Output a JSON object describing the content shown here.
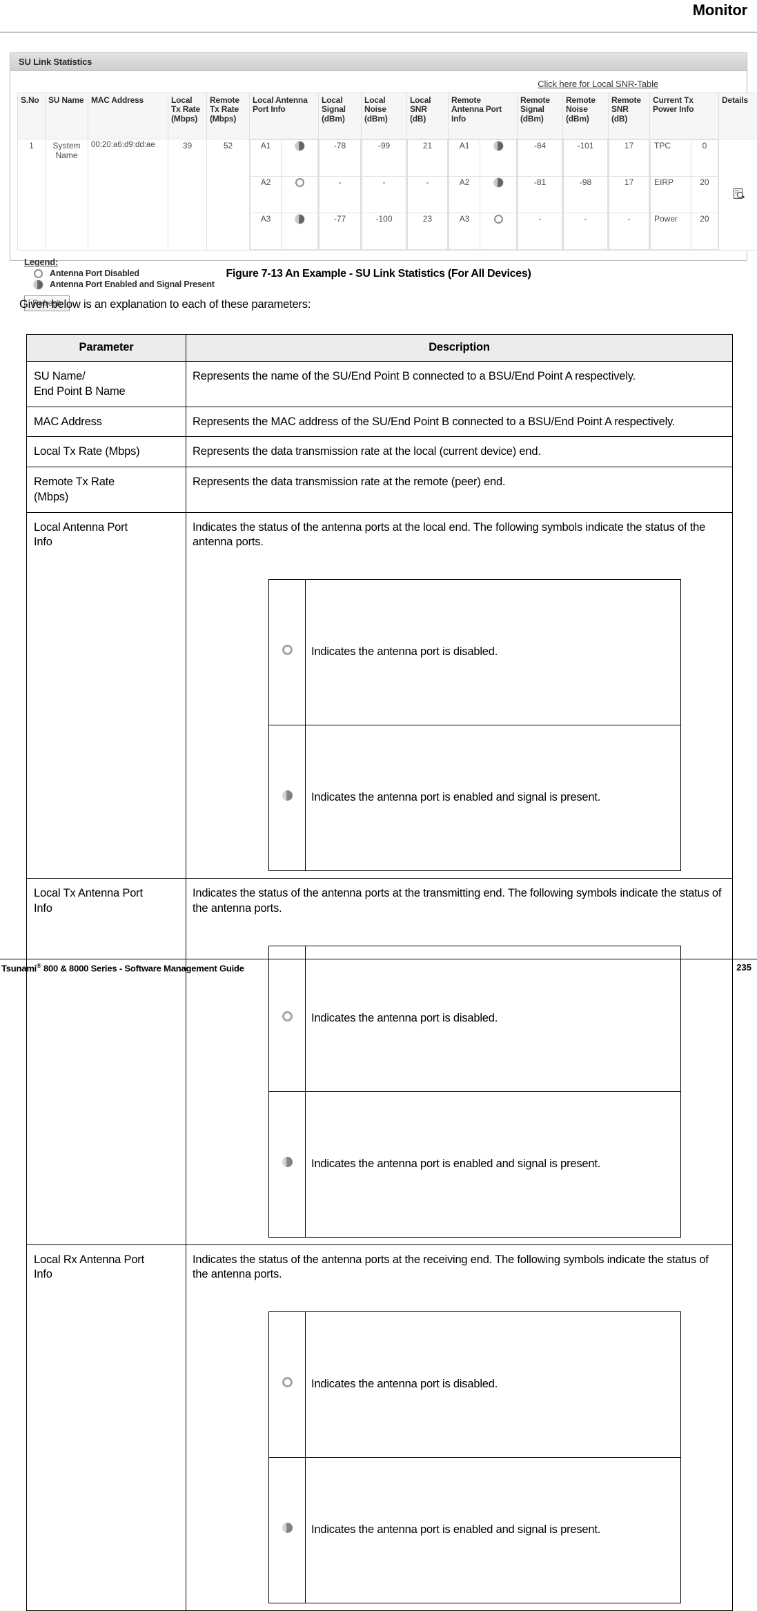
{
  "page": {
    "running_head": "Monitor",
    "footer_left_main": "Tsunami",
    "footer_left_sup": "®",
    "footer_left_rest": " 800 & 8000 Series - Software Management Guide",
    "footer_page_number": "235"
  },
  "screenshot": {
    "panel_title": "SU Link Statistics",
    "snr_link": "Click here for Local SNR-Table",
    "columns": [
      "S.No",
      "SU Name",
      "MAC Address",
      "Local Tx Rate (Mbps)",
      "Remote Tx Rate (Mbps)",
      "Local Antenna Port Info",
      "Local Signal (dBm)",
      "Local Noise (dBm)",
      "Local SNR (dB)",
      "Remote Antenna Port Info",
      "Remote Signal (dBm)",
      "Remote Noise (dBm)",
      "Remote SNR (dB)",
      "Current Tx Power Info",
      "Details"
    ],
    "row": {
      "sno": "1",
      "su_name": "System Name",
      "mac_address": "00:20:a6:d9:dd:ae",
      "local_tx_rate": "39",
      "remote_tx_rate": "52",
      "local_antenna_ports": [
        {
          "label": "A1",
          "state": "enabled"
        },
        {
          "label": "A2",
          "state": "disabled"
        },
        {
          "label": "A3",
          "state": "enabled"
        }
      ],
      "local_signal": [
        "-78",
        "-",
        "-77"
      ],
      "local_noise": [
        "-99",
        "-",
        "-100"
      ],
      "local_snr": [
        "21",
        "-",
        "23"
      ],
      "remote_antenna_ports": [
        {
          "label": "A1",
          "state": "enabled"
        },
        {
          "label": "A2",
          "state": "enabled"
        },
        {
          "label": "A3",
          "state": "disabled"
        }
      ],
      "remote_signal": [
        "-84",
        "-81",
        "-"
      ],
      "remote_noise": [
        "-101",
        "-98",
        "-"
      ],
      "remote_snr": [
        "17",
        "17",
        "-"
      ],
      "current_tx_power": [
        {
          "label": "TPC",
          "value": "0"
        },
        {
          "label": "EIRP",
          "value": "20"
        },
        {
          "label": "Power",
          "value": "20"
        }
      ],
      "details_icon": "details-magnifier-icon"
    },
    "legend": {
      "title": "Legend:",
      "items": [
        {
          "state": "disabled",
          "text": "Antenna Port Disabled"
        },
        {
          "state": "enabled",
          "text": "Antenna Port Enabled and Signal Present"
        }
      ]
    },
    "refresh_button": "Refresh"
  },
  "figure_caption": "Figure 7-13 An Example - SU Link Statistics (For All Devices)",
  "intro_paragraph": "Given below is an explanation to each of these parameters:",
  "param_table": {
    "headers": {
      "parameter": "Parameter",
      "description": "Description"
    },
    "symbol_legend": {
      "disabled": "Indicates the antenna port is disabled.",
      "enabled": "Indicates the antenna port is enabled and signal is present."
    },
    "rows": [
      {
        "parameter": "SU Name/\nEnd Point B Name",
        "description": "Represents the name of the SU/End Point B connected to a BSU/End Point A respectively.",
        "has_symbols": false
      },
      {
        "parameter": "MAC Address",
        "description": "Represents the MAC address of the SU/End Point B connected to a BSU/End Point A respectively.",
        "has_symbols": false
      },
      {
        "parameter": "Local Tx Rate (Mbps)",
        "description": "Represents the data transmission rate at the local (current device) end.",
        "has_symbols": false
      },
      {
        "parameter": "Remote Tx Rate\n(Mbps)",
        "description": "Represents the data transmission rate at the remote (peer) end.",
        "has_symbols": false
      },
      {
        "parameter": "Local Antenna Port\nInfo",
        "description": "Indicates the status of the antenna ports at the local end. The following symbols indicate the status of the antenna ports.",
        "has_symbols": true
      },
      {
        "parameter": "Local Tx Antenna Port\nInfo",
        "description": "Indicates the status of the antenna ports at the transmitting end. The following symbols indicate the status of the antenna ports.",
        "has_symbols": true
      },
      {
        "parameter": "Local Rx Antenna Port\nInfo",
        "description": "Indicates the status of the antenna ports at the receiving end. The following symbols indicate the status of the antenna ports.",
        "has_symbols": true
      }
    ]
  }
}
